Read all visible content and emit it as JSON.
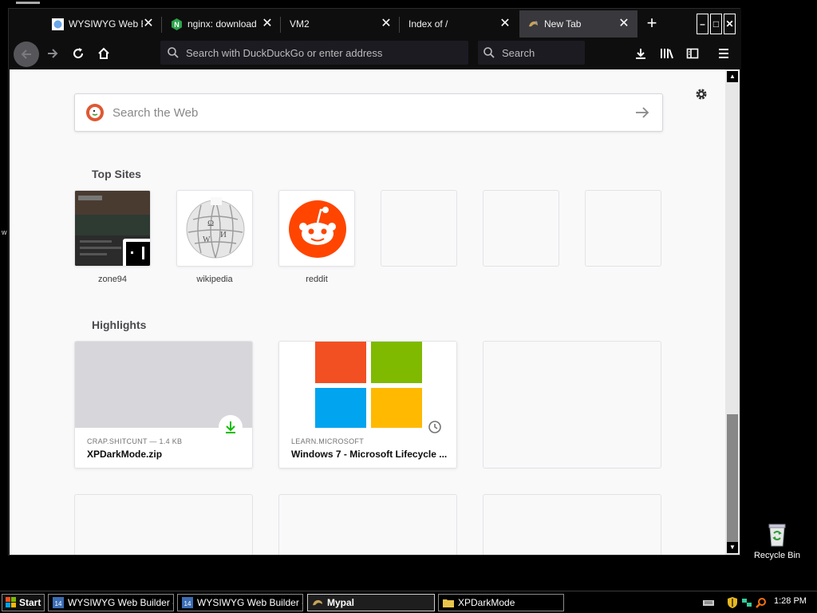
{
  "desktop": {
    "recycle_bin_label": "Recycle Bin"
  },
  "tabs": [
    {
      "title": "WYSIWYG Web Bu",
      "icon": "globe-icon"
    },
    {
      "title": "nginx: download",
      "icon": "nginx-icon"
    },
    {
      "title": "VM2",
      "icon": ""
    },
    {
      "title": "Index of /",
      "icon": ""
    },
    {
      "title": "New Tab",
      "icon": "firefox-icon",
      "active": true
    }
  ],
  "toolbar": {
    "url_placeholder": "Search with DuckDuckGo or enter address",
    "search_placeholder": "Search"
  },
  "newtab": {
    "search_placeholder": "Search the Web",
    "top_sites_heading": "Top Sites",
    "top_sites": [
      {
        "label": "zone94"
      },
      {
        "label": "wikipedia"
      },
      {
        "label": "reddit"
      },
      {
        "label": ""
      },
      {
        "label": ""
      },
      {
        "label": ""
      }
    ],
    "highlights_heading": "Highlights",
    "highlights": [
      {
        "source": "CRAP.SHITCUNT — 1.4 KB",
        "title": "XPDarkMode.zip",
        "badge": "download-icon"
      },
      {
        "source": "LEARN.MICROSOFT",
        "title": "Windows 7 - Microsoft Lifecycle ...",
        "badge": "clock-icon"
      }
    ]
  },
  "taskbar": {
    "start_label": "Start",
    "tasks": [
      {
        "label": "WYSIWYG Web Builder - ..."
      },
      {
        "label": "WYSIWYG Web Builder - ..."
      },
      {
        "label": "Mypal",
        "active": true
      },
      {
        "label": "XPDarkMode"
      }
    ],
    "clock": "1:28 PM"
  },
  "colors": {
    "chrome_bg": "#0e0e0e",
    "active_tab": "#38383d",
    "page_bg": "#f9f9fa",
    "reddit": "#ff4500",
    "download_green": "#2ac3a2"
  }
}
